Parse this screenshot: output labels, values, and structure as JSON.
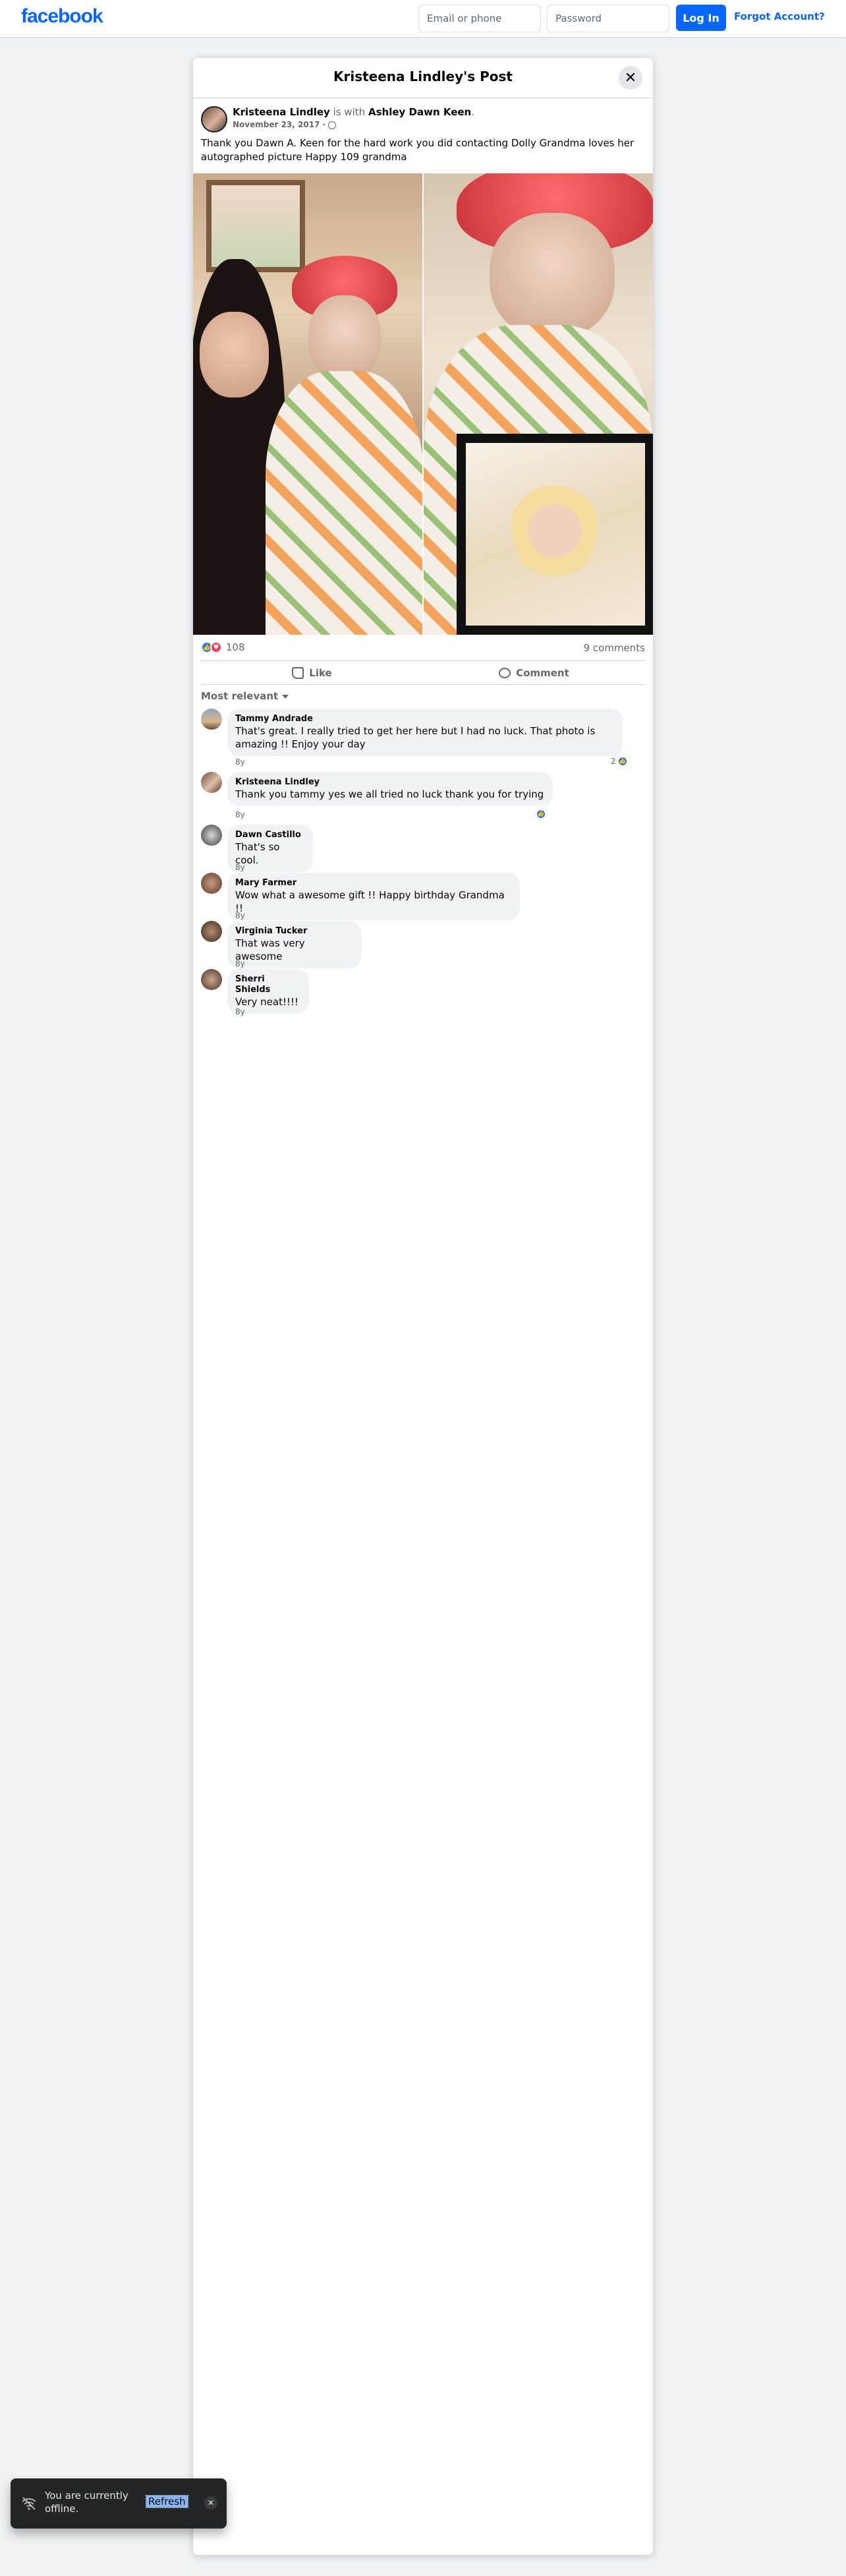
{
  "topbar": {
    "logo": "facebook",
    "email_placeholder": "Email or phone",
    "password_placeholder": "Password",
    "login_label": "Log In",
    "forgot_label": "Forgot Account?"
  },
  "post": {
    "title": "Kristeena Lindley's Post",
    "close_glyph": "✕",
    "author": "Kristeena Lindley",
    "with_text": "is with",
    "tagged": "Ashley Dawn Keen",
    "date": "November 23, 2017 ·",
    "text": "Thank you Dawn A. Keen for the hard work you did contacting Dolly Grandma loves her autographed picture Happy 109 grandma",
    "reaction_count": "108",
    "comment_count": "9 comments",
    "like_label": "Like",
    "comment_label": "Comment",
    "sort_label": "Most relevant"
  },
  "comments": [
    {
      "name": "Tammy Andrade",
      "text": "That's great. I really tried to get her here but I had no luck. That photo is amazing !! Enjoy your day",
      "by": "8y",
      "likes": "2"
    },
    {
      "name": "Kristeena Lindley",
      "text": "Thank you tammy yes we all tried no luck thank you for trying",
      "by": "8y",
      "likes": ""
    },
    {
      "name": "Dawn Castillo",
      "text": "That's so cool.",
      "by": "8y"
    },
    {
      "name": "Mary Farmer",
      "text": "Wow what a awesome gift !! Happy birthday Grandma !!",
      "by": "8y"
    },
    {
      "name": "Virginia Tucker",
      "text": "That was very awesome",
      "by": "8y"
    },
    {
      "name": "Sherri Shields",
      "text": "Very neat!!!!",
      "by": "8y"
    }
  ],
  "toast": {
    "message": "You are currently offline.",
    "refresh_label": "Refresh",
    "close_glyph": "✕"
  },
  "colors": {
    "brand": "#0866ff",
    "like_blue": "#1877f2",
    "love_red": "#f33e58"
  }
}
